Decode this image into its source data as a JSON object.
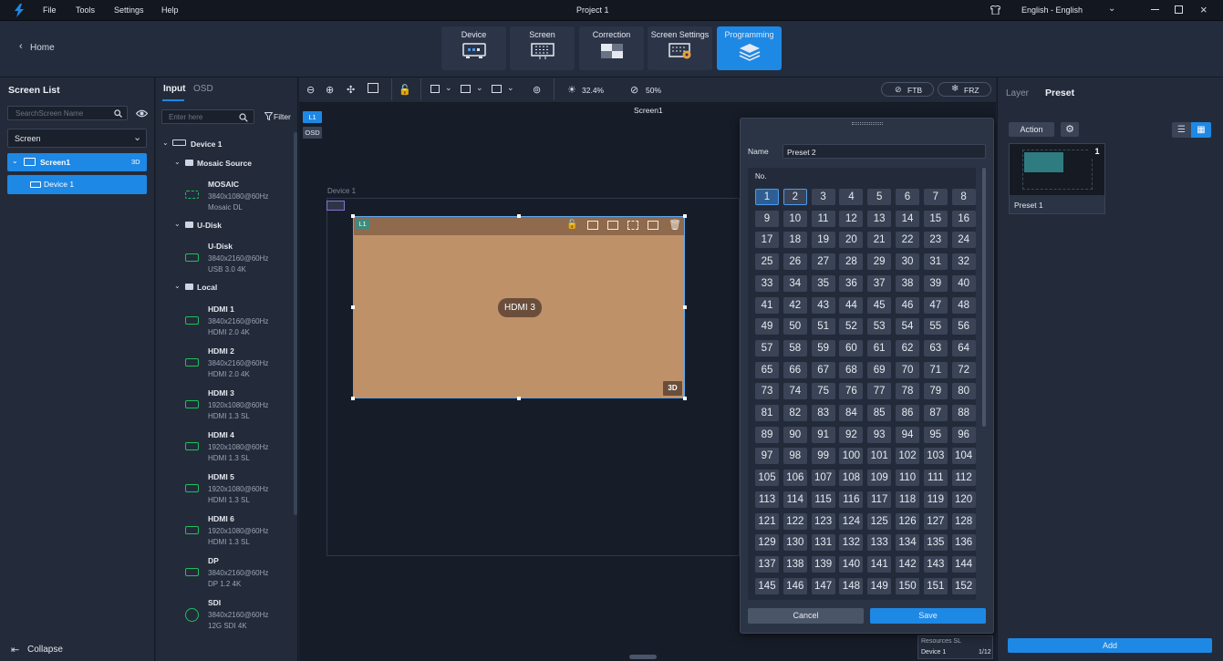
{
  "titlebar": {
    "menus": [
      "File",
      "Tools",
      "Settings",
      "Help"
    ],
    "project": "Project 1",
    "language": "English - English"
  },
  "home": {
    "label": "Home"
  },
  "nav_tabs": [
    {
      "label": "Device",
      "active": false
    },
    {
      "label": "Screen",
      "active": false
    },
    {
      "label": "Correction",
      "active": false
    },
    {
      "label": "Screen Settings",
      "active": false
    },
    {
      "label": "Programming",
      "active": true
    }
  ],
  "screen_list": {
    "title": "Screen List",
    "search_placeholder": "SearchScreen Name",
    "dropdown": "Screen",
    "screen_item": "Screen1",
    "screen_badge": "3D",
    "device_item": "Device 1",
    "collapse": "Collapse"
  },
  "input_panel": {
    "tabs": [
      "Input",
      "OSD"
    ],
    "search_placeholder": "Enter here",
    "filter": "Filter",
    "device": "Device 1",
    "groups": [
      "Mosaic Source",
      "U-Disk",
      "Local"
    ],
    "sources": [
      {
        "name": "MOSAIC",
        "res": "3840x1080@60Hz",
        "type": "Mosaic DL"
      },
      {
        "name": "U-Disk",
        "res": "3840x2160@60Hz",
        "type": "USB 3.0 4K"
      },
      {
        "name": "HDMI 1",
        "res": "3840x2160@60Hz",
        "type": "HDMI 2.0 4K"
      },
      {
        "name": "HDMI 2",
        "res": "3840x2160@60Hz",
        "type": "HDMI 2.0 4K"
      },
      {
        "name": "HDMI 3",
        "res": "1920x1080@60Hz",
        "type": "HDMI 1.3 SL"
      },
      {
        "name": "HDMI 4",
        "res": "1920x1080@60Hz",
        "type": "HDMI 1.3 SL"
      },
      {
        "name": "HDMI 5",
        "res": "1920x1080@60Hz",
        "type": "HDMI 1.3 SL"
      },
      {
        "name": "HDMI 6",
        "res": "1920x1080@60Hz",
        "type": "HDMI 1.3 SL"
      },
      {
        "name": "DP",
        "res": "3840x2160@60Hz",
        "type": "DP 1.2 4K"
      },
      {
        "name": "SDI",
        "res": "3840x2160@60Hz",
        "type": "12G SDI 4K"
      }
    ]
  },
  "canvas_toolbar": {
    "brightness": "32.4%",
    "opacity": "50%",
    "ftb": "FTB",
    "frz": "FRZ"
  },
  "canvas": {
    "screen_label": "Screen1",
    "layer_tag": "L1",
    "osd_tag": "OSD",
    "device_label": "Device 1",
    "window_layer": "L1",
    "window_source": "HDMI 3",
    "window_badge": "3D",
    "resources_label": "Resources SL",
    "device_row": "Device 1",
    "device_count": "1/12"
  },
  "preset_dialog": {
    "name_label": "Name",
    "name_value": "Preset 2",
    "no_label": "No.",
    "numbers": [
      "1",
      "2",
      "3",
      "4",
      "5",
      "6",
      "7",
      "8",
      "9",
      "10",
      "11",
      "12",
      "13",
      "14",
      "15",
      "16",
      "17",
      "18",
      "19",
      "20",
      "21",
      "22",
      "23",
      "24",
      "25",
      "26",
      "27",
      "28",
      "29",
      "30",
      "31",
      "32",
      "33",
      "34",
      "35",
      "36",
      "37",
      "38",
      "39",
      "40",
      "41",
      "42",
      "43",
      "44",
      "45",
      "46",
      "47",
      "48",
      "49",
      "50",
      "51",
      "52",
      "53",
      "54",
      "55",
      "56",
      "57",
      "58",
      "59",
      "60",
      "61",
      "62",
      "63",
      "64",
      "65",
      "66",
      "67",
      "68",
      "69",
      "70",
      "71",
      "72",
      "73",
      "74",
      "75",
      "76",
      "77",
      "78",
      "79",
      "80",
      "81",
      "82",
      "83",
      "84",
      "85",
      "86",
      "87",
      "88",
      "89",
      "90",
      "91",
      "92",
      "93",
      "94",
      "95",
      "96",
      "97",
      "98",
      "99",
      "100",
      "101",
      "102",
      "103",
      "104",
      "105",
      "106",
      "107",
      "108",
      "109",
      "110",
      "111",
      "112",
      "113",
      "114",
      "115",
      "116",
      "117",
      "118",
      "119",
      "120",
      "121",
      "122",
      "123",
      "124",
      "125",
      "126",
      "127",
      "128",
      "129",
      "130",
      "131",
      "132",
      "133",
      "134",
      "135",
      "136",
      "137",
      "138",
      "139",
      "140",
      "141",
      "142",
      "143",
      "144",
      "145",
      "146",
      "147",
      "148",
      "149",
      "150",
      "151",
      "152"
    ],
    "cancel": "Cancel",
    "save": "Save"
  },
  "right_panel": {
    "tabs": [
      "Layer",
      "Preset"
    ],
    "action": "Action",
    "preset_number": "1",
    "preset_name": "Preset 1",
    "add": "Add"
  },
  "colors": {
    "accent": "#1e88e5",
    "window_fill": "#bf9169",
    "green": "#1fbf5b"
  }
}
